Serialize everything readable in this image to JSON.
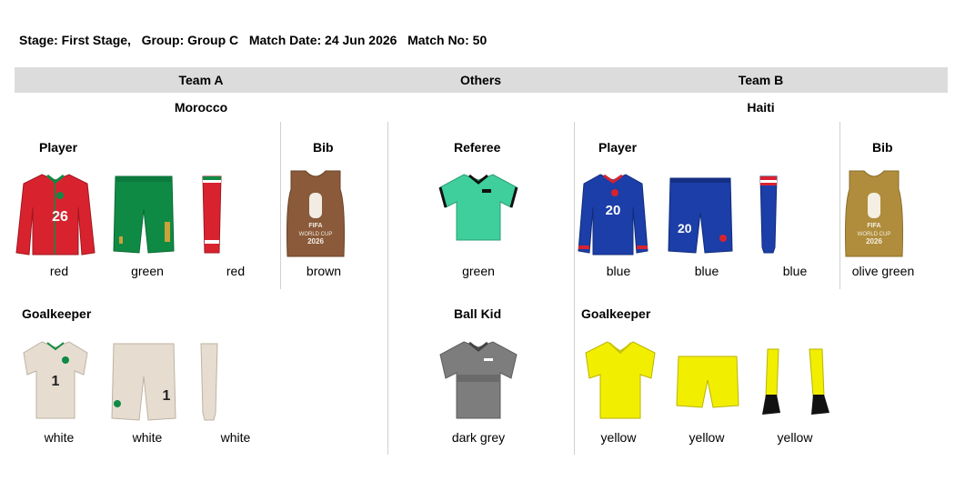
{
  "match_info": {
    "stage": "Stage: First Stage,",
    "group": "Group: Group C",
    "date": "Match Date: 24 Jun 2026",
    "match_no": "Match No: 50"
  },
  "header": {
    "team_a": "Team A",
    "others": "Others",
    "team_b": "Team B"
  },
  "team_a": {
    "name": "Morocco",
    "player": {
      "title": "Player",
      "shirt_number": "26",
      "colors": [
        "red",
        "green",
        "red"
      ]
    },
    "bib": {
      "title": "Bib",
      "color": "brown"
    },
    "goalkeeper": {
      "title": "Goalkeeper",
      "shirt_number": "1",
      "short_number": "1",
      "colors": [
        "white",
        "white",
        "white"
      ]
    }
  },
  "others": {
    "referee": {
      "title": "Referee",
      "color": "green"
    },
    "ball_kid": {
      "title": "Ball Kid",
      "color": "dark grey"
    }
  },
  "team_b": {
    "name": "Haiti",
    "player": {
      "title": "Player",
      "shirt_number": "20",
      "short_number": "20",
      "colors": [
        "blue",
        "blue",
        "blue"
      ]
    },
    "bib": {
      "title": "Bib",
      "color": "olive green"
    },
    "goalkeeper": {
      "title": "Goalkeeper",
      "colors": [
        "yellow",
        "yellow",
        "yellow"
      ]
    }
  },
  "bib_logo": {
    "line1": "FIFA",
    "line2": "WORLD CUP",
    "line3": "2026"
  },
  "palette": {
    "morocco_red": "#d8232f",
    "morocco_green": "#0f8a45",
    "bib_brown": "#8a5a3a",
    "gk_white": "#e6ddd0",
    "referee_green": "#3fcf9c",
    "ballkid_grey": "#7d7d7d",
    "haiti_blue": "#1b3ea8",
    "bib_olive": "#b08d3c",
    "gk_yellow": "#f2ee00"
  }
}
